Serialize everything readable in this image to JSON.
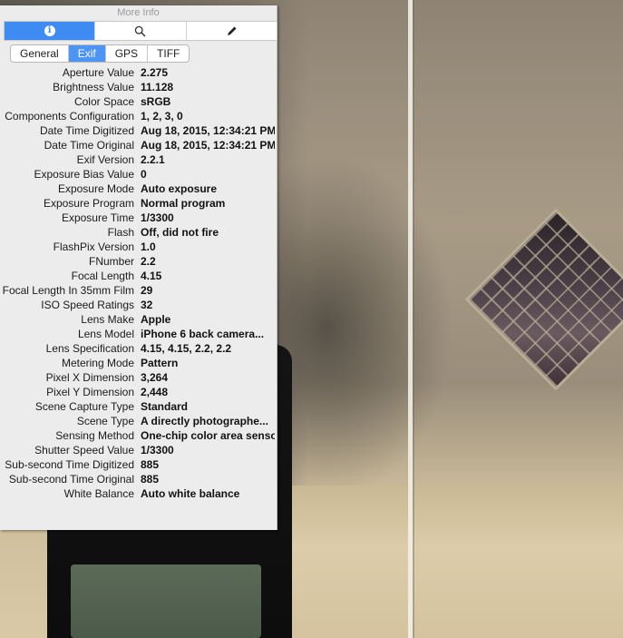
{
  "window": {
    "title": "More Info"
  },
  "icon_tabs": [
    {
      "name": "info",
      "icon": "info-icon",
      "active": true
    },
    {
      "name": "search",
      "icon": "magnifier-icon",
      "active": false
    },
    {
      "name": "edit",
      "icon": "pencil-icon",
      "active": false
    }
  ],
  "tabs": [
    {
      "label": "General",
      "active": false
    },
    {
      "label": "Exif",
      "active": true
    },
    {
      "label": "GPS",
      "active": false
    },
    {
      "label": "TIFF",
      "active": false
    }
  ],
  "exif": [
    {
      "key": "Aperture Value",
      "value": "2.275"
    },
    {
      "key": "Brightness Value",
      "value": "11.128"
    },
    {
      "key": "Color Space",
      "value": "sRGB"
    },
    {
      "key": "Components Configuration",
      "value": "1, 2, 3, 0"
    },
    {
      "key": "Date Time Digitized",
      "value": "Aug 18, 2015, 12:34:21 PM"
    },
    {
      "key": "Date Time Original",
      "value": "Aug 18, 2015, 12:34:21 PM"
    },
    {
      "key": "Exif Version",
      "value": "2.2.1"
    },
    {
      "key": "Exposure Bias Value",
      "value": "0"
    },
    {
      "key": "Exposure Mode",
      "value": "Auto exposure"
    },
    {
      "key": "Exposure Program",
      "value": "Normal program"
    },
    {
      "key": "Exposure Time",
      "value": "1/3300"
    },
    {
      "key": "Flash",
      "value": "Off, did not fire"
    },
    {
      "key": "FlashPix Version",
      "value": "1.0"
    },
    {
      "key": "FNumber",
      "value": "2.2"
    },
    {
      "key": "Focal Length",
      "value": "4.15"
    },
    {
      "key": "Focal Length In 35mm Film",
      "value": "29"
    },
    {
      "key": "ISO Speed Ratings",
      "value": "32"
    },
    {
      "key": "Lens Make",
      "value": "Apple"
    },
    {
      "key": "Lens Model",
      "value": "iPhone 6 back camera..."
    },
    {
      "key": "Lens Specification",
      "value": "4.15, 4.15, 2.2, 2.2"
    },
    {
      "key": "Metering Mode",
      "value": "Pattern"
    },
    {
      "key": "Pixel X Dimension",
      "value": "3,264"
    },
    {
      "key": "Pixel Y Dimension",
      "value": "2,448"
    },
    {
      "key": "Scene Capture Type",
      "value": "Standard"
    },
    {
      "key": "Scene Type",
      "value": "A directly photographe..."
    },
    {
      "key": "Sensing Method",
      "value": "One-chip color area sensor"
    },
    {
      "key": "Shutter Speed Value",
      "value": "1/3300"
    },
    {
      "key": "Sub-second Time Digitized",
      "value": "885"
    },
    {
      "key": "Sub-second Time Original",
      "value": "885"
    },
    {
      "key": "White Balance",
      "value": "Auto white balance"
    }
  ],
  "colors": {
    "accent": "#3e8cf3",
    "panel_bg": "#ececec"
  }
}
